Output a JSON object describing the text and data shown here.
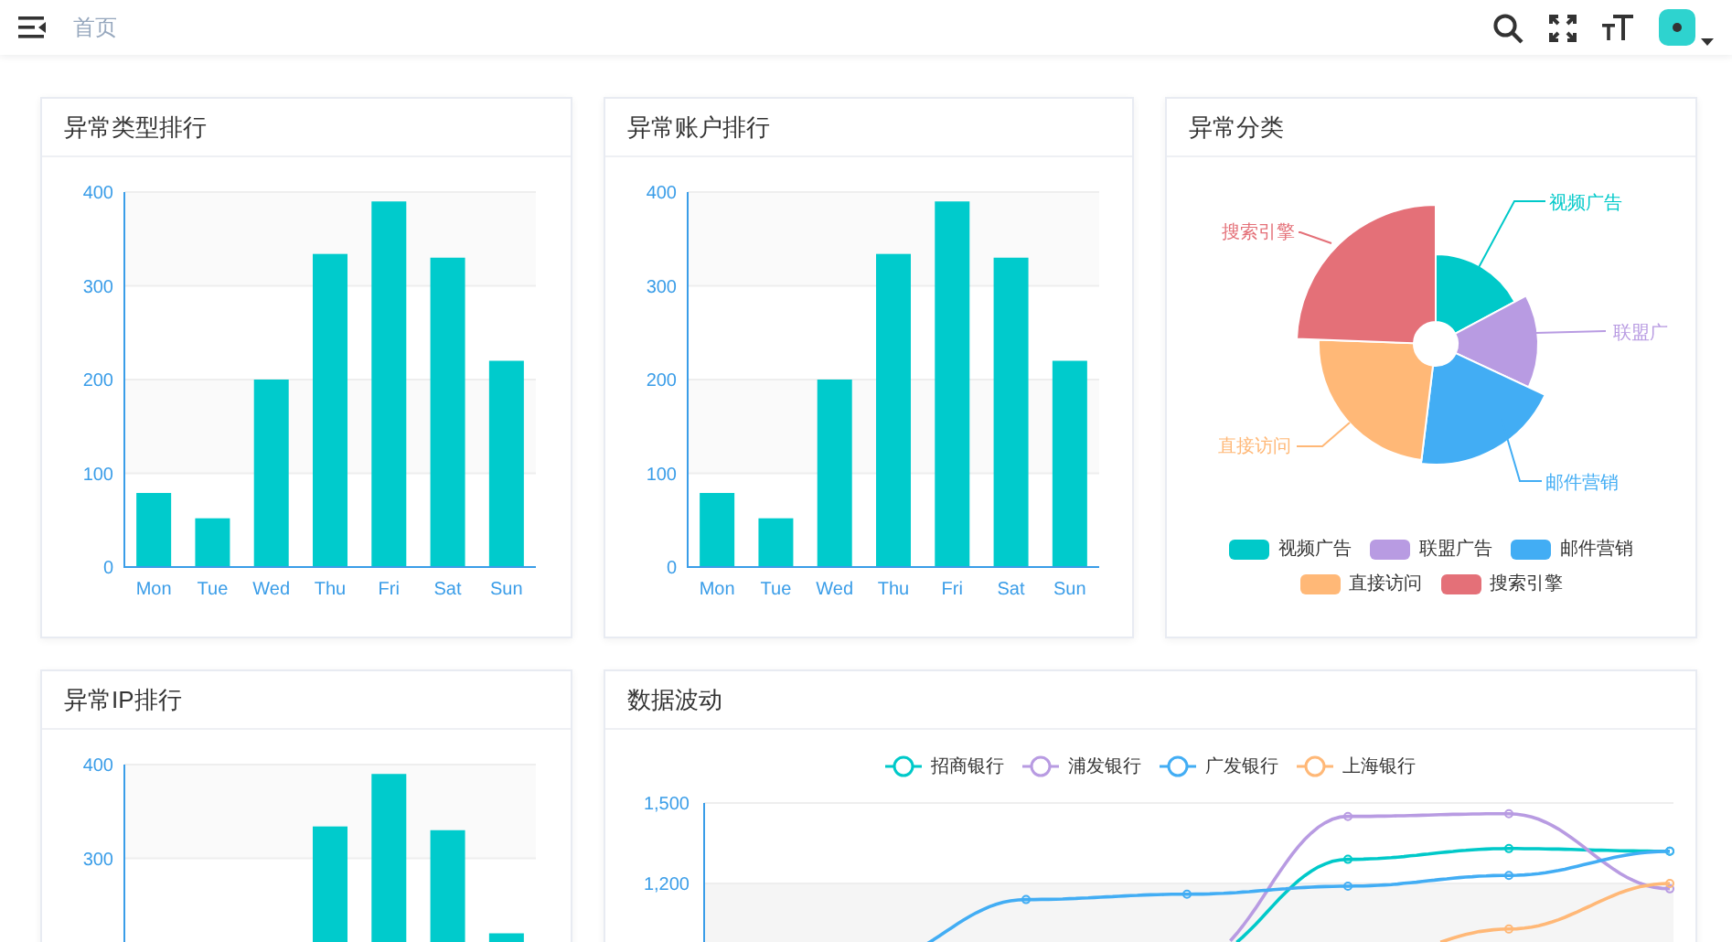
{
  "header": {
    "breadcrumb": "首页"
  },
  "cards": [
    {
      "title": "异常类型排行",
      "chart_data": {
        "type": "bar",
        "categories": [
          "Mon",
          "Tue",
          "Wed",
          "Thu",
          "Fri",
          "Sat",
          "Sun"
        ],
        "values": [
          79,
          52,
          200,
          334,
          390,
          330,
          220
        ],
        "ylim": [
          0,
          400
        ],
        "yticks": [
          0,
          100,
          200,
          300,
          400
        ],
        "grid": true
      }
    },
    {
      "title": "异常账户排行",
      "chart_data": {
        "type": "bar",
        "categories": [
          "Mon",
          "Tue",
          "Wed",
          "Thu",
          "Fri",
          "Sat",
          "Sun"
        ],
        "values": [
          79,
          52,
          200,
          334,
          390,
          330,
          220
        ],
        "ylim": [
          0,
          400
        ],
        "yticks": [
          0,
          100,
          200,
          300,
          400
        ],
        "grid": true
      }
    },
    {
      "kind": "pie",
      "title": "异常分类",
      "slice_labels": [
        {
          "text": "视频广告",
          "color": "#00c9c9"
        },
        {
          "text": "搜索引擎",
          "color": "#e47078"
        },
        {
          "text": "联盟广",
          "color": "#b89be2"
        },
        {
          "text": "直接访问",
          "color": "#ffb877"
        },
        {
          "text": "邮件营销",
          "color": "#42adf4"
        }
      ],
      "legend": [
        {
          "label": "视频广告",
          "color": "#00c9c9"
        },
        {
          "label": "联盟广告",
          "color": "#b89be2"
        },
        {
          "label": "邮件营销",
          "color": "#42adf4"
        },
        {
          "label": "直接访问",
          "color": "#ffb877"
        },
        {
          "label": "搜索引擎",
          "color": "#e47078"
        }
      ]
    },
    {
      "title": "异常IP排行",
      "chart_data": {
        "type": "bar",
        "values": [
          null,
          null,
          null,
          334,
          390,
          330,
          220
        ],
        "ylim": [
          0,
          400
        ],
        "yticks": [
          300,
          400
        ],
        "grid": true
      }
    },
    {
      "kind": "line",
      "title": "数据波动",
      "y_axis_labels": [
        "1,500",
        "1,200"
      ],
      "legend": [
        {
          "name": "招商银行",
          "color": "#00c9c9"
        },
        {
          "name": "浦发银行",
          "color": "#b89be2"
        },
        {
          "name": "广发银行",
          "color": "#42adf4"
        },
        {
          "name": "上海银行",
          "color": "#ffb877"
        }
      ]
    }
  ]
}
